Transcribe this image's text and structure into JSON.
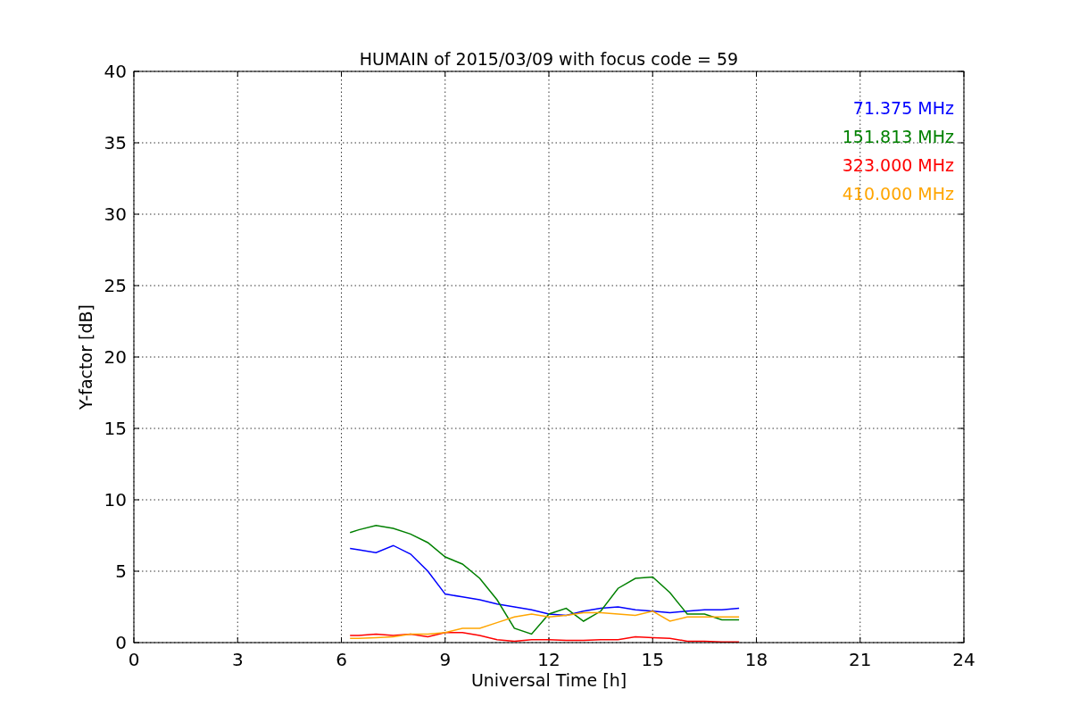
{
  "figure": {
    "chart_data": {
      "type": "line",
      "title": "HUMAIN of 2015/03/09 with focus code = 59",
      "xlabel": "Universal Time [h]",
      "ylabel": "Y-factor [dB]",
      "x": [
        6.25,
        6.5,
        7,
        7.5,
        8,
        8.5,
        9,
        9.5,
        10,
        10.5,
        11,
        11.5,
        12,
        12.5,
        13,
        13.5,
        14,
        14.5,
        15,
        15.5,
        16,
        16.5,
        17,
        17.5
      ],
      "series": [
        {
          "name": "71.375 MHz",
          "color": "#0000ff",
          "values": [
            6.6,
            6.5,
            6.3,
            6.8,
            6.2,
            5.0,
            3.4,
            3.2,
            3.0,
            2.7,
            2.5,
            2.3,
            2.0,
            1.9,
            2.2,
            2.4,
            2.5,
            2.3,
            2.2,
            2.1,
            2.2,
            2.3,
            2.3,
            2.4
          ]
        },
        {
          "name": "151.813 MHz",
          "color": "#008000",
          "values": [
            7.7,
            7.9,
            8.2,
            8.0,
            7.6,
            7.0,
            6.0,
            5.5,
            4.5,
            3.0,
            1.0,
            0.6,
            2.0,
            2.4,
            1.5,
            2.2,
            3.8,
            4.5,
            4.6,
            3.5,
            2.0,
            2.0,
            1.6,
            1.6
          ]
        },
        {
          "name": "323.000 MHz",
          "color": "#ff0000",
          "values": [
            0.5,
            0.5,
            0.6,
            0.5,
            0.6,
            0.4,
            0.7,
            0.7,
            0.5,
            0.2,
            0.1,
            0.2,
            0.2,
            0.15,
            0.15,
            0.2,
            0.2,
            0.4,
            0.35,
            0.3,
            0.1,
            0.1,
            0.05,
            0.05
          ]
        },
        {
          "name": "410.000 MHz",
          "color": "#ffa500",
          "values": [
            0.3,
            0.3,
            0.35,
            0.4,
            0.6,
            0.6,
            0.7,
            1.0,
            1.0,
            1.4,
            1.8,
            2.0,
            1.8,
            1.9,
            2.1,
            2.1,
            2.0,
            1.9,
            2.2,
            1.5,
            1.8,
            1.8,
            1.8,
            1.8
          ]
        }
      ],
      "xlim": [
        0,
        24
      ],
      "ylim": [
        0,
        40
      ],
      "xticks": [
        0,
        3,
        6,
        9,
        12,
        15,
        18,
        21,
        24
      ],
      "yticks": [
        0,
        5,
        10,
        15,
        20,
        25,
        30,
        35,
        40
      ],
      "grid": true
    }
  }
}
